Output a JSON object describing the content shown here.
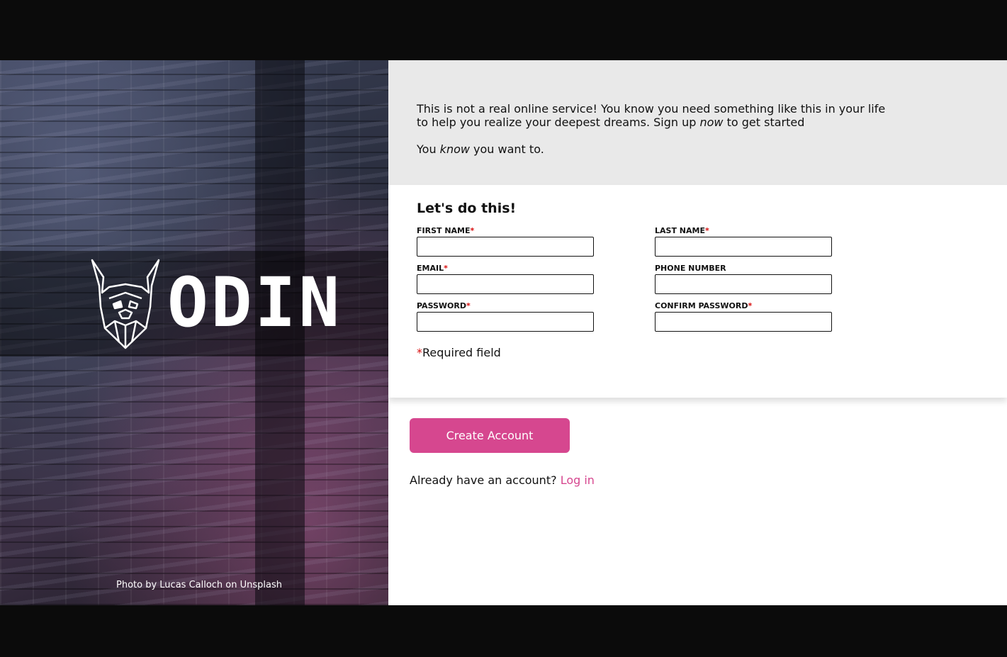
{
  "hero": {
    "logo_text": "ODIN",
    "photo_credit": "Photo by Lucas Calloch on Unsplash"
  },
  "intro": {
    "line1_a": "This is not a real online service! You know you need something like this in your life to help you realize your deepest dreams. Sign up ",
    "line1_em": "now",
    "line1_b": " to get started",
    "line2_a": "You ",
    "line2_em": "know",
    "line2_b": " you want to."
  },
  "form": {
    "title": "Let's do this!",
    "required_marker": "*",
    "fields": {
      "first_name": {
        "label": "FIRST NAME",
        "required": true,
        "value": ""
      },
      "last_name": {
        "label": "LAST NAME",
        "required": true,
        "value": ""
      },
      "email": {
        "label": "EMAIL",
        "required": true,
        "value": ""
      },
      "phone": {
        "label": "PHONE NUMBER",
        "required": false,
        "value": ""
      },
      "password": {
        "label": "PASSWORD",
        "required": true,
        "value": ""
      },
      "confirm_password": {
        "label": "CONFIRM PASSWORD",
        "required": true,
        "value": ""
      }
    },
    "required_note": "Required field"
  },
  "actions": {
    "create_label": "Create Account",
    "login_prompt": "Already have an account?",
    "login_link": "Log in"
  },
  "colors": {
    "accent": "#d6478f",
    "required": "#d80d0d",
    "intro_bg": "#e9e9e9"
  }
}
